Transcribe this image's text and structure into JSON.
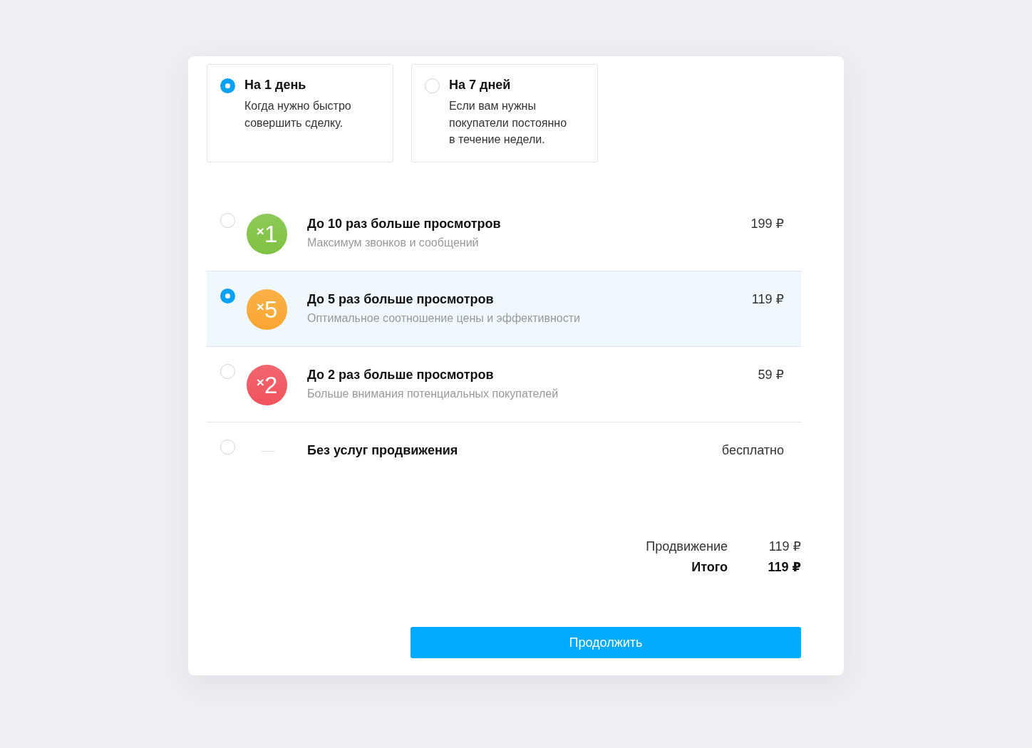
{
  "durations": [
    {
      "title": "На 1 день",
      "description": "Когда нужно быстро совершить сделку.",
      "selected": true
    },
    {
      "title": "На 7 дней",
      "description": "Если вам нужны покупатели постоянно в течение недели.",
      "selected": false
    }
  ],
  "options": [
    {
      "kind": "badge",
      "badge": "$^{×}$1",
      "color": "#7ec242",
      "title": "До 10 раз больше просмотров",
      "subtitle": "Максимум звонков и сообщений",
      "price": "199 ₽",
      "selected": false
    },
    {
      "kind": "badge",
      "badge": "$^{×}$5",
      "color": "#f9a630",
      "title": "До 5 раз больше просмотров",
      "subtitle": "Оптимальное соотношение цены и эффективности",
      "price": "119 ₽",
      "selected": true
    },
    {
      "kind": "badge",
      "badge": "$^{×}$2",
      "color": "#f1525c",
      "title": "До 2 раз больше просмотров",
      "subtitle": "Больше внимания потенциальных покупателей",
      "price": "59 ₽",
      "selected": false
    },
    {
      "kind": "none",
      "title": "Без услуг продвижения",
      "price": "бесплатно",
      "selected": false
    }
  ],
  "summary": [
    {
      "kind": "line",
      "label": "Продвижение",
      "value": "119 ₽"
    },
    {
      "kind": "total",
      "label": "Итого",
      "value": "119 ₽"
    }
  ],
  "continue_button": {
    "label": "Продолжить"
  }
}
